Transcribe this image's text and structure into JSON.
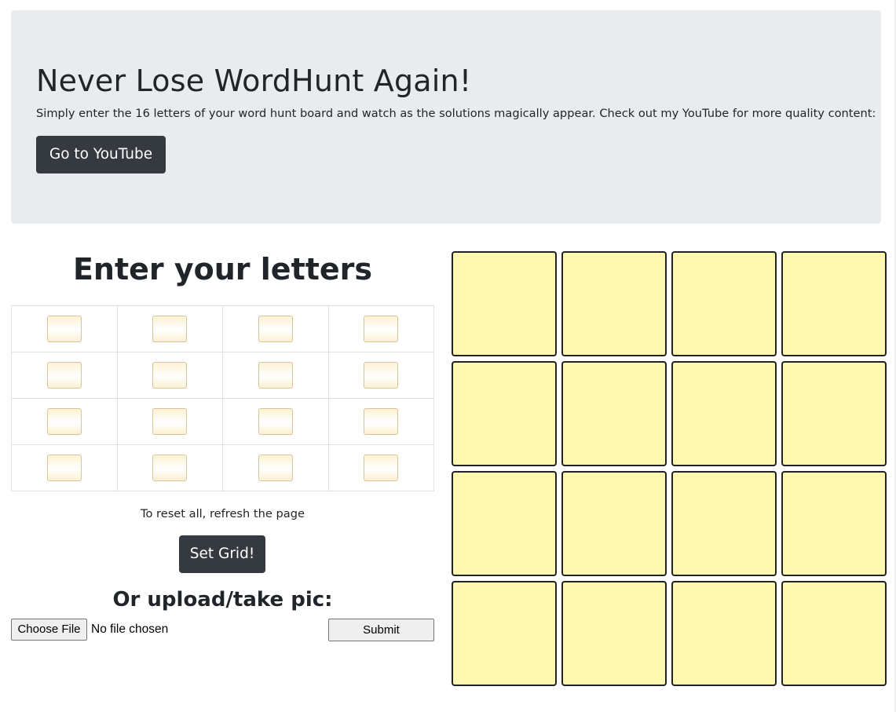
{
  "header": {
    "title": "Never Lose WordHunt Again!",
    "description": "Simply enter the 16 letters of your word hunt board and watch as the solutions magically appear. Check out my YouTube for more quality content:",
    "youtube_button": "Go to YouTube"
  },
  "input_panel": {
    "title": "Enter your letters",
    "grid_rows": 4,
    "grid_cols": 4,
    "letters": [
      "",
      "",
      "",
      "",
      "",
      "",
      "",
      "",
      "",
      "",
      "",
      "",
      "",
      "",
      "",
      ""
    ],
    "reset_note": "To reset all, refresh the page",
    "set_button": "Set Grid!",
    "upload_title": "Or upload/take pic:",
    "file_button": "Choose File",
    "file_status": "No file chosen",
    "submit_button": "Submit"
  },
  "board": {
    "tiles": [
      "",
      "",
      "",
      "",
      "",
      "",
      "",
      "",
      "",
      "",
      "",
      "",
      "",
      "",
      "",
      ""
    ],
    "tile_color": "#fff8b0",
    "border_color": "#222222"
  },
  "colors": {
    "jumbotron_bg": "#e9ecef",
    "button_dark": "#343a40"
  }
}
